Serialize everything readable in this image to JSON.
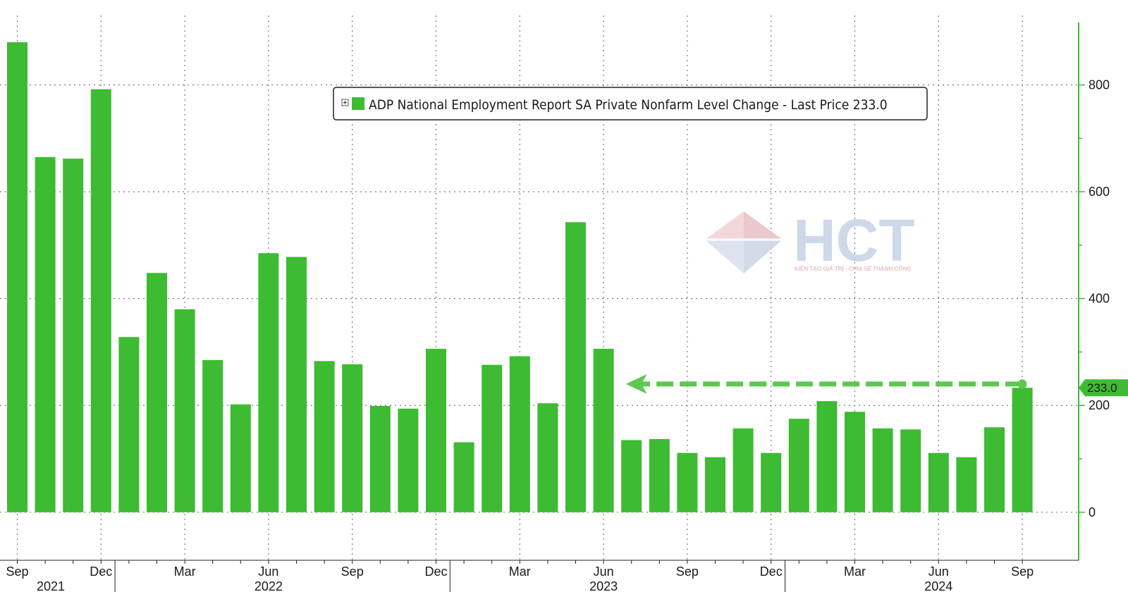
{
  "chart_data": {
    "type": "bar",
    "legend_text": "ADP National Employment Report SA Private Nonfarm Level Change - Last Price 233.0",
    "last_value_label": "233.0",
    "last_value": 233.0,
    "ylim": [
      -90,
      930
    ],
    "yticks": [
      0,
      200,
      400,
      600,
      800
    ],
    "grid": true,
    "legend_position": "top-center",
    "color": "#3dbb32",
    "series": [
      {
        "values": [
          880,
          665,
          662,
          792,
          328,
          448,
          380,
          285,
          202,
          485,
          478,
          283,
          277,
          199,
          194,
          306,
          131,
          276,
          292,
          204,
          543,
          306,
          135,
          137,
          111,
          103,
          157,
          111,
          175,
          208,
          188,
          157,
          155,
          111,
          103,
          159,
          233
        ]
      }
    ],
    "month_ticks": [
      {
        "label": "Sep",
        "index": 0
      },
      {
        "label": "Dec",
        "index": 3
      },
      {
        "label": "Mar",
        "index": 6
      },
      {
        "label": "Jun",
        "index": 9
      },
      {
        "label": "Sep",
        "index": 12
      },
      {
        "label": "Dec",
        "index": 15
      },
      {
        "label": "Mar",
        "index": 18
      },
      {
        "label": "Jun",
        "index": 21
      },
      {
        "label": "Sep",
        "index": 24
      },
      {
        "label": "Dec",
        "index": 27
      },
      {
        "label": "Mar",
        "index": 30
      },
      {
        "label": "Jun",
        "index": 33
      },
      {
        "label": "Sep",
        "index": 36
      }
    ],
    "year_ticks": [
      {
        "label": "2021",
        "index": 1.2
      },
      {
        "label": "2022",
        "index": 9
      },
      {
        "label": "2023",
        "index": 21
      },
      {
        "label": "2024",
        "index": 33
      }
    ],
    "year_separators": [
      3.5,
      15.5,
      27.5
    ],
    "arrow": {
      "from_index": 36,
      "to_index": 22,
      "value": 240
    }
  },
  "watermark": {
    "brand": "HCT",
    "tagline": "KIẾN TẠO GIÁ TRỊ - CHIA SẺ THÀNH CÔNG"
  }
}
